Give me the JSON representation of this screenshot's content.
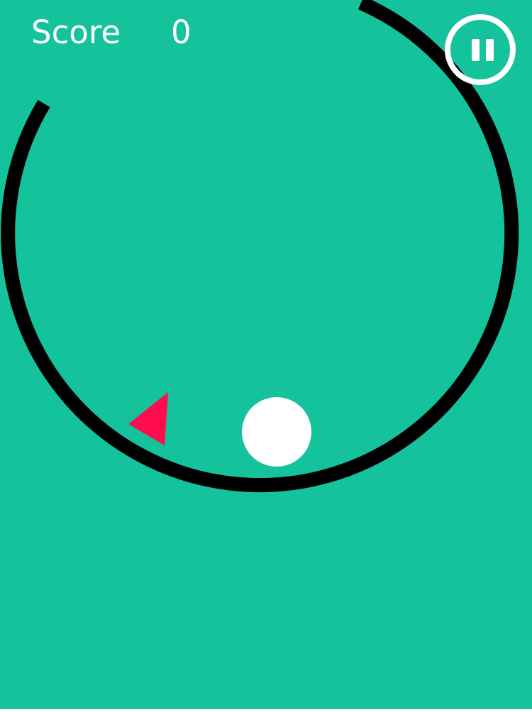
{
  "colors": {
    "background": "#14c29c",
    "track": "#000000",
    "ball": "#ffffff",
    "spike": "#ff0b4f",
    "hud_text": "#ffffff"
  },
  "hud": {
    "score_label": "Score",
    "score_value": "0"
  },
  "icons": {
    "pause": "pause-icon"
  },
  "track": {
    "shape": "circle",
    "gap": "upper-left"
  },
  "obstacles": [
    {
      "type": "spike-triangle"
    }
  ]
}
